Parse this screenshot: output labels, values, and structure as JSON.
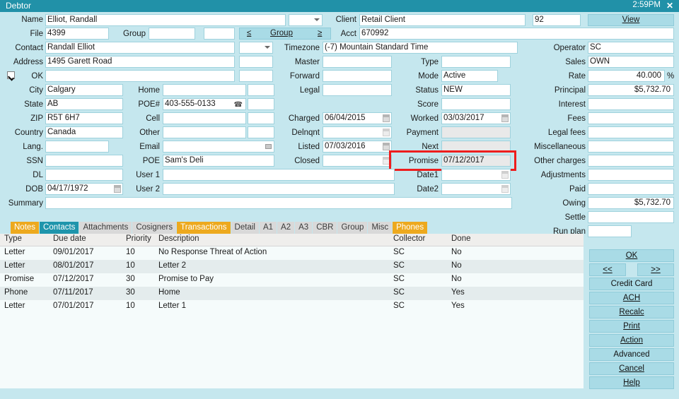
{
  "window": {
    "title": "Debtor",
    "clock": "2:59PM",
    "close_label": "✕"
  },
  "form": {
    "left_labels": {
      "name": "Name",
      "file": "File",
      "group": "Group",
      "contact": "Contact",
      "address": "Address",
      "ok": "OK",
      "city": "City",
      "state": "State",
      "zip": "ZIP",
      "country": "Country",
      "lang": "Lang.",
      "ssn": "SSN",
      "dl": "DL",
      "dob": "DOB",
      "summary": "Summary"
    },
    "left_values": {
      "name": "Elliot, Randall",
      "file": "4399",
      "group": "",
      "contact": "Randall Elliot",
      "address": "1495 Garett Road",
      "address2": "",
      "city": "Calgary",
      "state": "AB",
      "zip": "R5T 6H7",
      "country": "Canada",
      "lang": "",
      "ssn": "",
      "dl": "",
      "dob": "04/17/1972",
      "summary": ""
    },
    "mid_labels": {
      "home": "Home",
      "poe_num": "POE#",
      "cell": "Cell",
      "other": "Other",
      "email": "Email",
      "poe": "POE",
      "user1": "User 1",
      "user2": "User 2"
    },
    "mid_values": {
      "home": "",
      "poe_num": "403-555-0133",
      "cell": "",
      "other": "",
      "email": "",
      "poe": "Sam's Deli",
      "user1": "",
      "user2": ""
    },
    "group_nav": {
      "prev": "≤",
      "label": "Group",
      "next": "≥"
    },
    "col3_labels": {
      "timezone": "Timezone",
      "master": "Master",
      "forward": "Forward",
      "legal": "Legal",
      "charged": "Charged",
      "delnqnt": "Delnqnt",
      "listed": "Listed",
      "closed": "Closed"
    },
    "col3_values": {
      "timezone": "(-7) Mountain Standard Time",
      "master": "",
      "forward": "",
      "legal": "",
      "charged": "06/04/2015",
      "delnqnt": "",
      "listed": "07/03/2016",
      "closed": ""
    },
    "col4_labels": {
      "client": "Client",
      "acct": "Acct",
      "type": "Type",
      "mode": "Mode",
      "status": "Status",
      "score": "Score",
      "worked": "Worked",
      "payment": "Payment",
      "next": "Next",
      "promise": "Promise",
      "date1": "Date1",
      "date2": "Date2"
    },
    "col4_values": {
      "client": "Retail Client",
      "client_code": "92",
      "acct": "670992",
      "type": "",
      "mode": "Active",
      "status": "NEW",
      "score": "",
      "worked": "03/03/2017",
      "payment": "",
      "next": "",
      "promise": "07/12/2017",
      "date1": "",
      "date2": ""
    },
    "view_button": "View",
    "money_labels": {
      "operator": "Operator",
      "sales": "Sales",
      "rate": "Rate",
      "principal": "Principal",
      "interest": "Interest",
      "fees": "Fees",
      "legal_fees": "Legal fees",
      "miscellaneous": "Miscellaneous",
      "other_charges": "Other charges",
      "adjustments": "Adjustments",
      "paid": "Paid",
      "owing": "Owing",
      "settle": "Settle",
      "run_plan": "Run plan"
    },
    "money_values": {
      "operator": "SC",
      "sales": "OWN",
      "rate": "40.000",
      "rate_suffix": "%",
      "principal": "$5,732.70",
      "interest": "",
      "fees": "",
      "legal_fees": "",
      "miscellaneous": "",
      "other_charges": "",
      "adjustments": "",
      "paid": "",
      "owing": "$5,732.70",
      "settle": "",
      "run_plan": ""
    }
  },
  "tabs": [
    {
      "label": "Notes",
      "style": "orange"
    },
    {
      "label": "Contacts",
      "style": "active"
    },
    {
      "label": "Attachments",
      "style": "plain"
    },
    {
      "label": "Cosigners",
      "style": "plain"
    },
    {
      "label": "Transactions",
      "style": "orange"
    },
    {
      "label": "Detail",
      "style": "plain"
    },
    {
      "label": "A1",
      "style": "plain"
    },
    {
      "label": "A2",
      "style": "plain"
    },
    {
      "label": "A3",
      "style": "plain"
    },
    {
      "label": "CBR",
      "style": "plain"
    },
    {
      "label": "Group",
      "style": "plain"
    },
    {
      "label": "Misc",
      "style": "plain"
    },
    {
      "label": "Phones",
      "style": "orange"
    }
  ],
  "grid": {
    "columns": [
      "Type",
      "Due date",
      "Priority",
      "Description",
      "Collector",
      "Done"
    ],
    "rows": [
      {
        "type": "Letter",
        "due": "09/01/2017",
        "priority": "10",
        "description": "No Response Threat of Action",
        "collector": "SC",
        "done": "No"
      },
      {
        "type": "Letter",
        "due": "08/01/2017",
        "priority": "10",
        "description": "Letter 2",
        "collector": "SC",
        "done": "No"
      },
      {
        "type": "Promise",
        "due": "07/12/2017",
        "priority": "30",
        "description": "Promise to Pay",
        "collector": "SC",
        "done": "No"
      },
      {
        "type": "Phone",
        "due": "07/11/2017",
        "priority": "30",
        "description": "Home",
        "collector": "SC",
        "done": "Yes"
      },
      {
        "type": "Letter",
        "due": "07/01/2017",
        "priority": "10",
        "description": "Letter 1",
        "collector": "SC",
        "done": "Yes"
      }
    ]
  },
  "buttons": {
    "ok": "OK",
    "prev": "<<",
    "next": ">>",
    "credit_card": "Credit Card",
    "ach": "ACH",
    "recalc": "Recalc",
    "print": "Print",
    "action": "Action",
    "advanced": "Advanced",
    "cancel": "Cancel",
    "help": "Help"
  },
  "colors": {
    "titlebar": "#2191a8",
    "background": "#c5e7ee",
    "tab_orange": "#eda91e",
    "tab_active": "#1f95ac",
    "highlight": "#ee1d1d",
    "button": "#a9dbe6"
  }
}
